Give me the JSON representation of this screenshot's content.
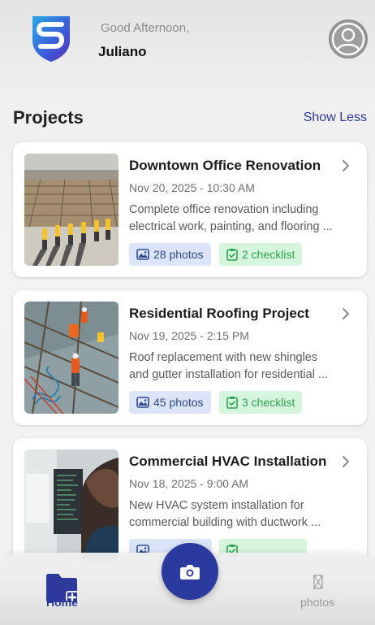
{
  "header": {
    "greeting": "Good Afternoon,",
    "user_name": "Juliano"
  },
  "section": {
    "title": "Projects",
    "toggle_label": "Show Less"
  },
  "projects": [
    {
      "title": "Downtown Office Renovation",
      "date": "Nov 20, 2025 - 10:30 AM",
      "desc_line1": "Complete office renovation including",
      "desc_line2": "electrical work, painting, and flooring ...",
      "photos": "28 photos",
      "checklist": "2 checklist"
    },
    {
      "title": "Residential Roofing Project",
      "date": "Nov 19, 2025 - 2:15 PM",
      "desc_line1": "Roof replacement with new shingles",
      "desc_line2": "and gutter installation for residential ...",
      "photos": "45 photos",
      "checklist": "3 checklist"
    },
    {
      "title": "Commercial HVAC Installation",
      "date": "Nov 18, 2025 - 9:00 AM",
      "desc_line1": "New HVAC system installation for",
      "desc_line2": "commercial building with ductwork ..."
    }
  ],
  "bottom_nav": {
    "home_label": "Home",
    "photos_label": "photos"
  },
  "colors": {
    "accent": "#2d3a9b",
    "photos_badge_bg": "#dbe5f7",
    "checklist_badge_bg": "#d5f5dc",
    "checklist_text": "#2ea44f"
  },
  "icons": {
    "logo": "shield-s-logo",
    "avatar": "user-avatar-icon",
    "chevron": "chevron-right-icon",
    "photos": "image-icon",
    "checklist": "clipboard-check-icon",
    "home": "folder-plus-icon",
    "camera": "camera-icon",
    "photos_nav": "missing-glyph-icon"
  }
}
